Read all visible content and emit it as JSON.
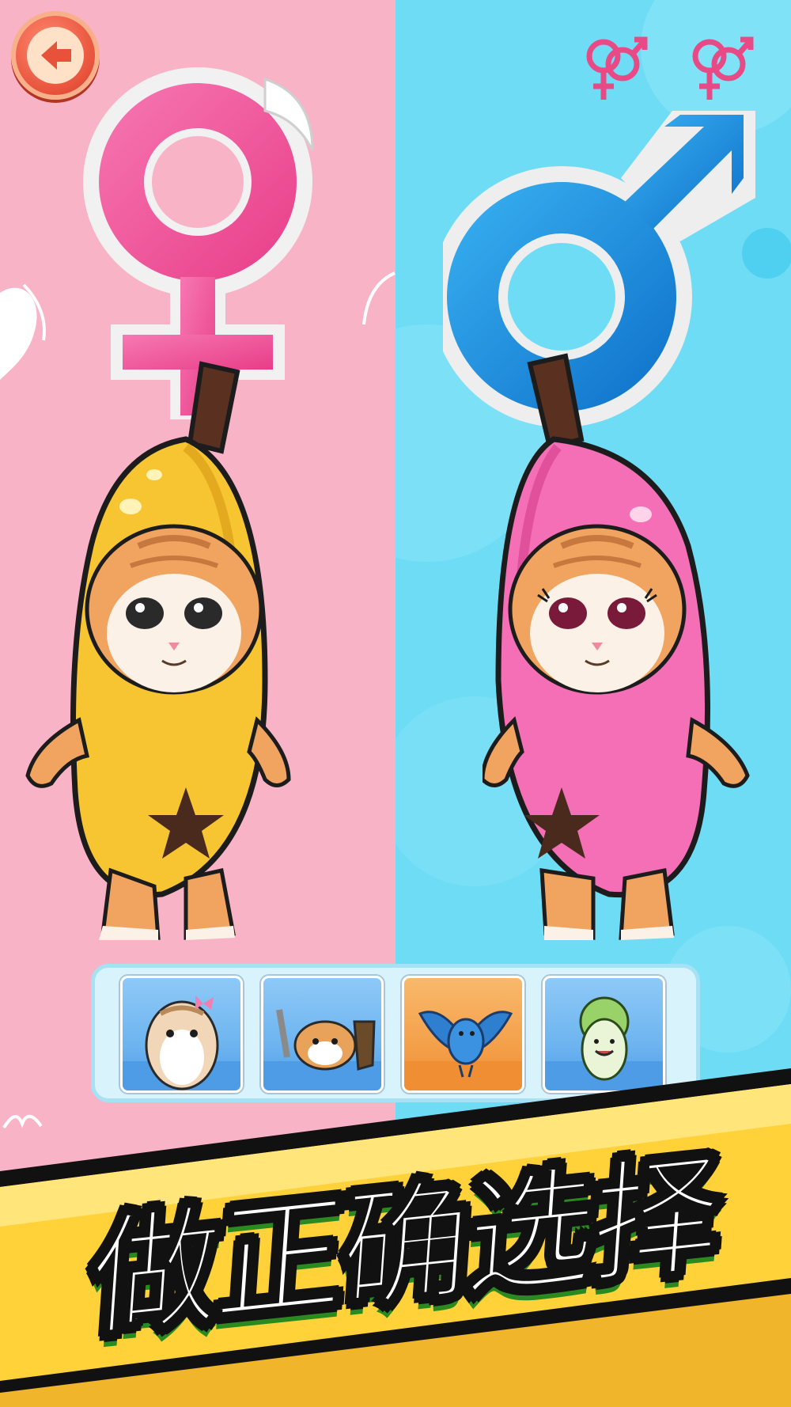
{
  "game": {
    "banner_text": "做正确选择",
    "colors": {
      "left_bg": "#f9b3c6",
      "right_bg": "#6fdcf5",
      "female_pink": "#f0559b",
      "male_blue": "#1a8fe0",
      "banana_yellow": "#f6c531",
      "banana_pink": "#f46fb5",
      "banner_yellow": "#ffd23a",
      "text_green": "#55d234"
    },
    "icons": {
      "back": "back-arrow-icon",
      "pair_icon_1": "female-male-pair-icon",
      "pair_icon_2": "female-male-pair-icon",
      "left_symbol": "female-symbol-icon",
      "right_symbol": "male-symbol-icon"
    },
    "choices": [
      {
        "name": "yellow-banana-cat",
        "side": "left"
      },
      {
        "name": "pink-banana-cat",
        "side": "right"
      }
    ],
    "tray_items": [
      {
        "name": "hamster-with-bow",
        "bg": "blue"
      },
      {
        "name": "doge-warrior",
        "bg": "blue"
      },
      {
        "name": "blue-bird",
        "bg": "orange"
      },
      {
        "name": "cabbage-character",
        "bg": "blue"
      }
    ]
  }
}
